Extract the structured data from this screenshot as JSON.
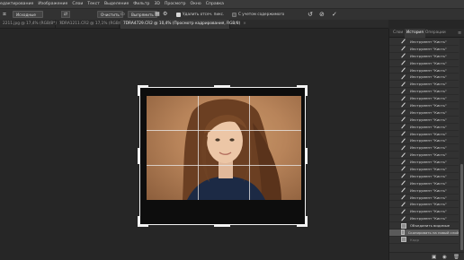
{
  "menu": [
    "едактирование",
    "Изображение",
    "Слои",
    "Текст",
    "Выделение",
    "Фильтр",
    "3D",
    "Просмотр",
    "Окно",
    "Справка"
  ],
  "options": {
    "ratio_select": "Исходные",
    "swap_icon": "swap-icon",
    "clear_button": "Очистить",
    "straighten_button": "Выпрямить",
    "delete_cropped_label": "Удалить отсеч. пикс.",
    "content_aware_label": "С учетом содержимого"
  },
  "tabs": [
    {
      "label": "2211.jpg @ 17,4% (RGB/8*)",
      "close": "×"
    },
    {
      "label": "7DRA1211.CR2 @ 17,1% (RGB/8)",
      "close": "×"
    },
    {
      "label": "7DRA4729.CR2 @ 10,4% (Просмотр кадрирования, RGB/8)",
      "close": "×"
    }
  ],
  "panel": {
    "tabs": [
      "Слои",
      "История",
      "Операции"
    ],
    "active_tab": "История",
    "history_items": [
      {
        "label": "Инструмент \"Кисть\"",
        "icon": "brush-icon"
      },
      {
        "label": "Инструмент \"Кисть\"",
        "icon": "brush-icon"
      },
      {
        "label": "Инструмент \"Кисть\"",
        "icon": "brush-icon"
      },
      {
        "label": "Инструмент \"Кисть\"",
        "icon": "brush-icon"
      },
      {
        "label": "Инструмент \"Кисть\"",
        "icon": "brush-icon"
      },
      {
        "label": "Инструмент \"Кисть\"",
        "icon": "brush-icon"
      },
      {
        "label": "Инструмент \"Кисть\"",
        "icon": "brush-icon"
      },
      {
        "label": "Инструмент \"Кисть\"",
        "icon": "brush-icon"
      },
      {
        "label": "Инструмент \"Кисть\"",
        "icon": "brush-icon"
      },
      {
        "label": "Инструмент \"Кисть\"",
        "icon": "brush-icon"
      },
      {
        "label": "Инструмент \"Кисть\"",
        "icon": "brush-icon"
      },
      {
        "label": "Инструмент \"Кисть\"",
        "icon": "brush-icon"
      },
      {
        "label": "Инструмент \"Кисть\"",
        "icon": "brush-icon"
      },
      {
        "label": "Инструмент \"Кисть\"",
        "icon": "brush-icon"
      },
      {
        "label": "Инструмент \"Кисть\"",
        "icon": "brush-icon"
      },
      {
        "label": "Инструмент \"Кисть\"",
        "icon": "brush-icon"
      },
      {
        "label": "Инструмент \"Кисть\"",
        "icon": "brush-icon"
      },
      {
        "label": "Инструмент \"Кисть\"",
        "icon": "brush-icon"
      },
      {
        "label": "Инструмент \"Кисть\"",
        "icon": "brush-icon"
      },
      {
        "label": "Инструмент \"Кисть\"",
        "icon": "brush-icon"
      },
      {
        "label": "Инструмент \"Кисть\"",
        "icon": "brush-icon"
      },
      {
        "label": "Инструмент \"Кисть\"",
        "icon": "brush-icon"
      },
      {
        "label": "Инструмент \"Кисть\"",
        "icon": "brush-icon"
      },
      {
        "label": "Инструмент \"Кисть\"",
        "icon": "brush-icon"
      },
      {
        "label": "Инструмент \"Кисть\"",
        "icon": "brush-icon"
      },
      {
        "label": "Инструмент \"Кисть\"",
        "icon": "brush-icon"
      },
      {
        "label": "Объединить видимые",
        "icon": "layer-icon"
      },
      {
        "label": "Скопировать на новый слой",
        "icon": "layer-icon",
        "active": true
      },
      {
        "label": "Кадр",
        "icon": "crop-icon",
        "greyed": true
      }
    ],
    "footer_icons": [
      "new-snapshot-icon",
      "camera-icon",
      "trash-icon"
    ]
  },
  "colors": {
    "app_bg": "#262626",
    "panel_bg": "#323232",
    "active_row": "#5a5a5a",
    "photo_backdrop": "#b8845a"
  }
}
